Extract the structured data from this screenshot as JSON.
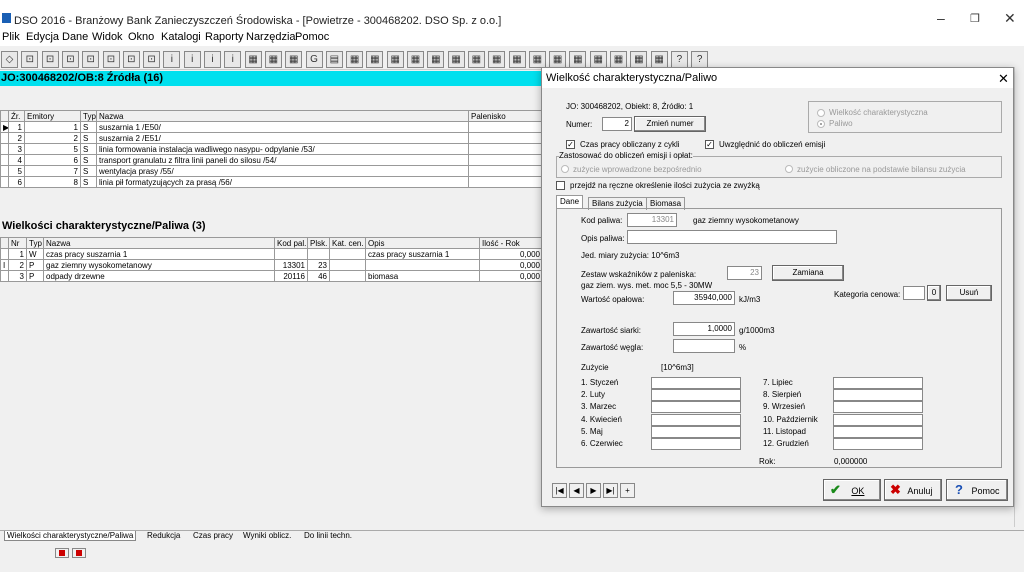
{
  "app": {
    "title": "DSO 2016 - Branżowy Bank Zanieczyszczeń Środowiska - [Powietrze - 300468202. DSO Sp. z o.o.]",
    "minimize": "–",
    "restore": "❐",
    "close": "✕"
  },
  "menu": [
    "Plik",
    "Edycja",
    "Dane",
    "Widok",
    "Okno",
    "Katalogi",
    "Raporty",
    "Narzędzia",
    "Pomoc"
  ],
  "toolbar_glyphs": [
    "◇",
    "⊡",
    "⊡",
    "⊡",
    "⊡",
    "⊡",
    "⊡",
    "⊡",
    "i",
    "i",
    "i",
    "i",
    "▦",
    "▦",
    "▦",
    "G",
    "▤",
    "▦",
    "▦",
    "▦",
    "▦",
    "▦",
    "▦",
    "▦",
    "▦",
    "▦",
    "▦",
    "▦",
    "▦",
    "▦",
    "▦",
    "▦",
    "▦",
    "?",
    "?"
  ],
  "main": {
    "header": "JO:300468202/OB:8 Źródła (16)",
    "sources": {
      "columns": [
        "Źr.",
        "Emitory",
        "Typ",
        "Nazwa",
        "Palenisko"
      ],
      "rows": [
        {
          "marker": "▶",
          "zr": "1",
          "em": "1",
          "typ": "S",
          "nazwa": "suszarnia 1 /E50/"
        },
        {
          "marker": "",
          "zr": "2",
          "em": "2",
          "typ": "S",
          "nazwa": "suszarnia 2 /E51/"
        },
        {
          "marker": "",
          "zr": "3",
          "em": "5",
          "typ": "S",
          "nazwa": "linia formowania instalacja wadliwego nasypu- odpylanie /53/"
        },
        {
          "marker": "",
          "zr": "4",
          "em": "6",
          "typ": "S",
          "nazwa": "transport granulatu z filtra linii paneli do silosu /54/"
        },
        {
          "marker": "",
          "zr": "5",
          "em": "7",
          "typ": "S",
          "nazwa": "wentylacja prasy /55/"
        },
        {
          "marker": "",
          "zr": "6",
          "em": "8",
          "typ": "S",
          "nazwa": "linia pił formatyzujących za prasą /56/"
        }
      ]
    },
    "fuel_heading": "Wielkości charakterystyczne/Paliwa (3)",
    "fuels": {
      "columns": [
        "Nr",
        "Typ",
        "Nazwa",
        "Kod pal.",
        "Plsk.",
        "Kat. cen.",
        "Opis",
        "Ilość - Rok"
      ],
      "rows": [
        {
          "marker": "",
          "nr": "1",
          "typ": "W",
          "nazwa": "czas pracy suszarnia 1",
          "kod": "",
          "plsk": "",
          "kat": "",
          "opis": "czas pracy suszarnia 1",
          "ilosc": "0,000"
        },
        {
          "marker": "I",
          "nr": "2",
          "typ": "P",
          "nazwa": "gaz ziemny wysokometanowy",
          "kod": "13301",
          "plsk": "23",
          "kat": "",
          "opis": "",
          "ilosc": "0,000"
        },
        {
          "marker": "",
          "nr": "3",
          "typ": "P",
          "nazwa": "odpady drzewne",
          "kod": "20116",
          "plsk": "46",
          "kat": "",
          "opis": "biomasa",
          "ilosc": "0,000"
        }
      ]
    }
  },
  "bottom_tabs": [
    "Wielkości charakterystyczne/Paliwa",
    "Redukcja",
    "Czas pracy",
    "Wyniki oblicz.",
    "Do linii techn."
  ],
  "dialog": {
    "title": "Wielkość charakterystyczna/Paliwo",
    "close": "✕",
    "info": "JO: 300468202, Obiekt: 8, Źródło: 1",
    "numer_label": "Numer:",
    "numer_value": "2",
    "zmien_numer": "Zmień numer",
    "radio_wielkosc": "Wielkość charakterystyczna",
    "radio_paliwo": "Paliwo",
    "chk_czas": "Czas pracy obliczany z cykli",
    "chk_uwzgl": "Uwzględnić do obliczeń emisji",
    "group_zastosowac": "Zastosować do obliczeń emisji i opłat:",
    "radio_zuzycie_wpr": "zużycie wprowadzone bezpośrednio",
    "radio_zuzycie_obl": "zużycie obliczone  na podstawie bilansu zużycia",
    "chk_przejdz": "przejdź na ręczne określenie ilości zużycia ze zwyżką",
    "tabs": [
      "Dane",
      "Bilans zużycia",
      "Biomasa"
    ],
    "kod_label": "Kod paliwa:",
    "kod_value": "13301",
    "kod_name": "gaz ziemny wysokometanowy",
    "opis_label": "Opis paliwa:",
    "jed_label": "Jed. miary zużycia: 10^6m3",
    "zestaw_label": "Zestaw wskaźników z paleniska:",
    "zestaw_value": "23",
    "zamiana": "Zamiana",
    "zestaw_desc": "gaz ziem. wys. met. moc 5,5 - 30MW",
    "wartosc_label": "Wartość opałowa:",
    "wartosc_value": "35940,000",
    "wartosc_unit": "kJ/m3",
    "kategoria_label": "Kategoria cenowa:",
    "kategoria_btn": "0",
    "usun": "Usuń",
    "siarka_label": "Zawartość siarki:",
    "siarka_value": "1,0000",
    "siarka_unit": "g/1000m3",
    "wegiel_label": "Zawartość węgla:",
    "wegiel_unit": "%",
    "zuzycie_label": "Zużycie",
    "zuzycie_unit": "[10^6m3]",
    "months_left": [
      "1. Styczeń",
      "2. Luty",
      "3. Marzec",
      "4. Kwiecień",
      "5. Maj",
      "6. Czerwiec"
    ],
    "months_right": [
      "7. Lipiec",
      "8. Sierpień",
      "9. Wrzesień",
      "10. Październik",
      "11. Listopad",
      "12. Grudzień"
    ],
    "rok_label": "Rok:",
    "rok_value": "0,000000",
    "nav": [
      "|◀",
      "◀",
      "▶",
      "▶|",
      "+"
    ],
    "ok": "OK",
    "anuluj": "Anuluj",
    "pomoc": "Pomoc"
  }
}
